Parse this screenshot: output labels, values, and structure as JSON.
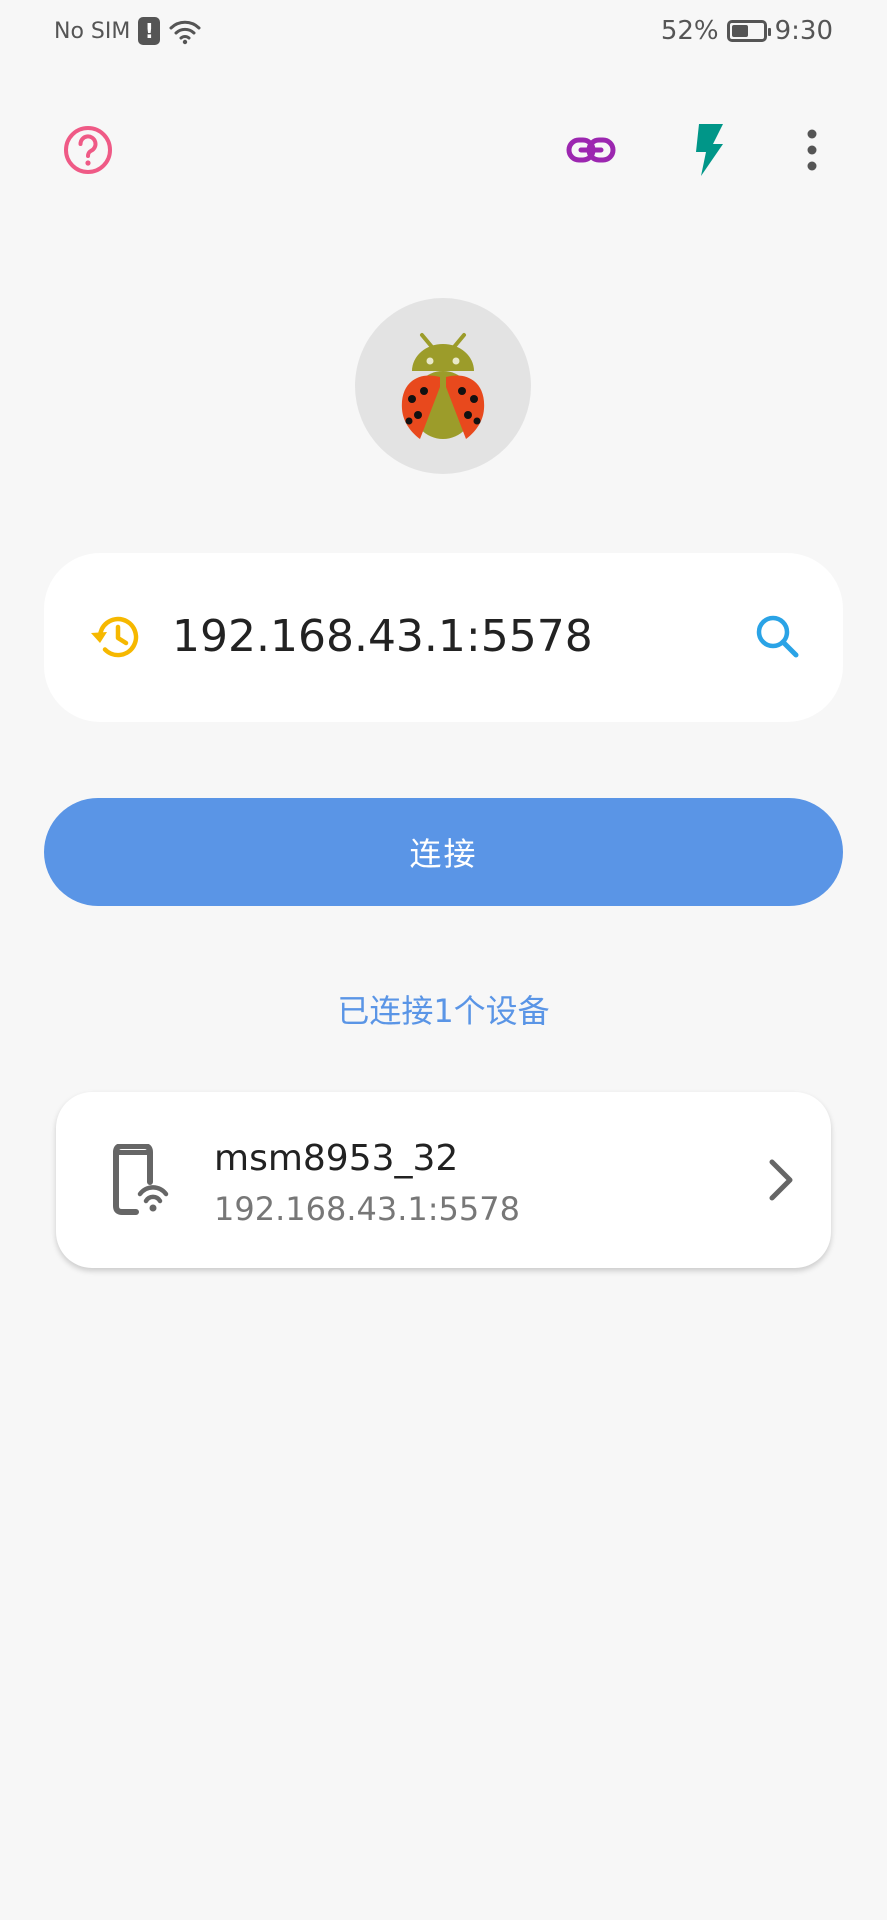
{
  "status_bar": {
    "carrier": "No SIM",
    "sim_alert_glyph": "!",
    "battery_percent": "52%",
    "battery_level": 0.52,
    "time": "9:30"
  },
  "toolbar": {
    "help_icon": "help-circle-icon",
    "link_icon": "link-icon",
    "flash_icon": "flash-icon",
    "more_icon": "more-vert-icon"
  },
  "colors": {
    "help": "#ef5a86",
    "link": "#9c27b0",
    "flash": "#009688",
    "accent": "#5a95e6",
    "history": "#f6b800",
    "search": "#2aa3e6"
  },
  "address_bar": {
    "value": "192.168.43.1:5578",
    "history_icon": "history-icon",
    "search_icon": "search-icon"
  },
  "connect_button": {
    "label": "连接"
  },
  "connected_summary": "已连接1个设备",
  "devices": [
    {
      "name": "msm8953_32",
      "address": "192.168.43.1:5578",
      "icon": "phone-wifi-icon"
    }
  ]
}
